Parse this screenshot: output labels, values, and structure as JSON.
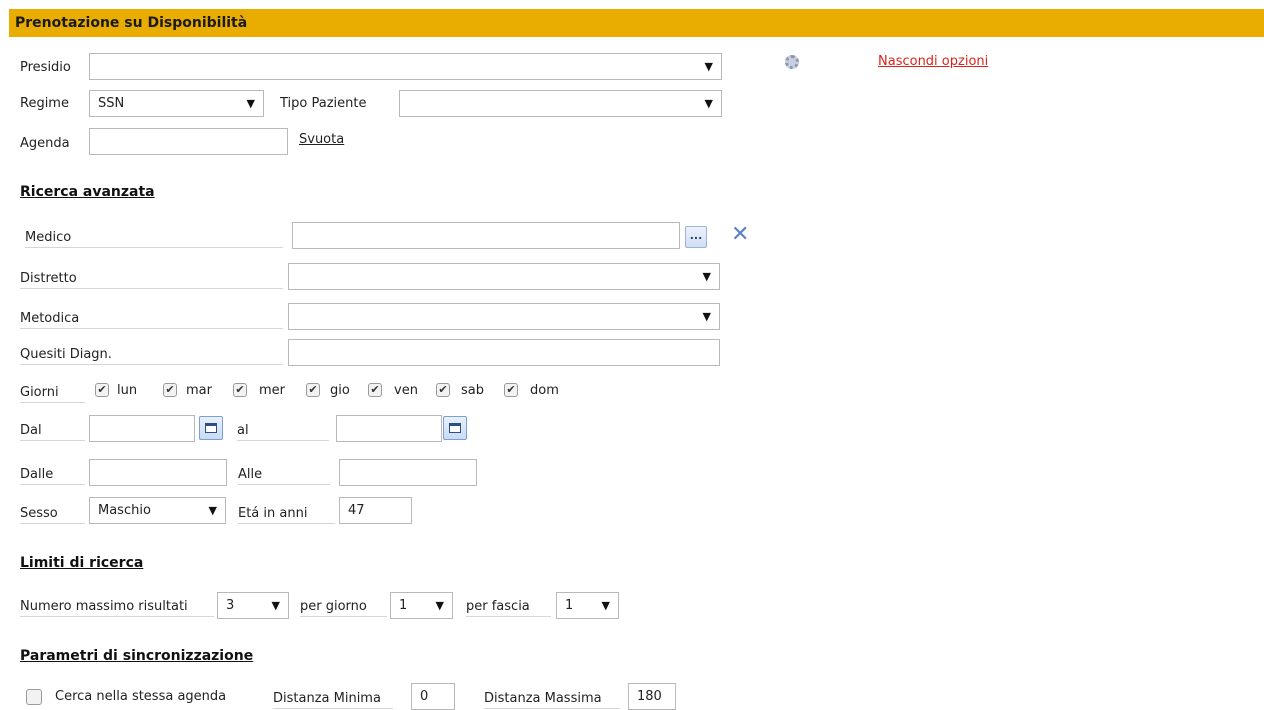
{
  "header": {
    "title": "Prenotazione su Disponibilità"
  },
  "form": {
    "presidio": {
      "label": "Presidio",
      "value": ""
    },
    "options_link": "Nascondi opzioni",
    "regime": {
      "label": "Regime",
      "value": "SSN"
    },
    "tipo_paziente": {
      "label": "Tipo Paziente",
      "value": ""
    },
    "agenda": {
      "label": "Agenda",
      "value": "",
      "clear_link": "Svuota"
    }
  },
  "advanced": {
    "title": "Ricerca avanzata",
    "medico": {
      "label": "Medico",
      "value": ""
    },
    "distretto": {
      "label": "Distretto",
      "value": ""
    },
    "metodica": {
      "label": "Metodica",
      "value": ""
    },
    "quesiti": {
      "label": "Quesiti Diagn.",
      "value": ""
    },
    "giorni": {
      "label": "Giorni",
      "days": [
        {
          "label": "lun",
          "checked": true
        },
        {
          "label": "mar",
          "checked": true
        },
        {
          "label": "mer",
          "checked": true
        },
        {
          "label": "gio",
          "checked": true
        },
        {
          "label": "ven",
          "checked": true
        },
        {
          "label": "sab",
          "checked": true
        },
        {
          "label": "dom",
          "checked": true
        }
      ]
    },
    "dal": {
      "label": "Dal",
      "value": ""
    },
    "al": {
      "label": "al",
      "value": ""
    },
    "dalle": {
      "label": "Dalle",
      "value": ""
    },
    "alle": {
      "label": "Alle",
      "value": ""
    },
    "sesso": {
      "label": "Sesso",
      "value": "Maschio"
    },
    "eta": {
      "label": "Etá in anni",
      "value": "47"
    }
  },
  "limits": {
    "title": "Limiti di ricerca",
    "max_results": {
      "label": "Numero massimo risultati",
      "value": "3"
    },
    "per_day": {
      "label": "per giorno",
      "value": "1"
    },
    "per_slot": {
      "label": "per fascia",
      "value": "1"
    }
  },
  "sync": {
    "title": "Parametri di sincronizzazione",
    "same_agenda": {
      "label": "Cerca nella stessa agenda",
      "checked": false
    },
    "min_distance": {
      "label": "Distanza Minima",
      "value": "0"
    },
    "max_distance": {
      "label": "Distanza Massima",
      "value": "180"
    }
  },
  "icons": {
    "dropdown": "▼",
    "check": "✔",
    "lookup": "...",
    "clear": "✕"
  }
}
